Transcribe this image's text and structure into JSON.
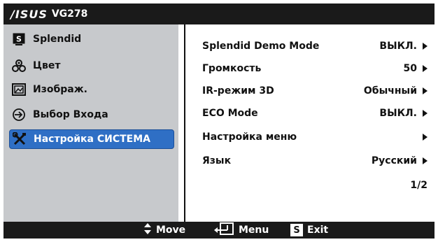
{
  "header": {
    "brand_logo": "/ISUS",
    "model": "VG278"
  },
  "sidebar": {
    "items": [
      {
        "label": "Splendid",
        "icon": "splendid-s-icon"
      },
      {
        "label": "Цвет",
        "icon": "color-drops-icon"
      },
      {
        "label": "Изображ.",
        "icon": "image-frame-icon"
      },
      {
        "label": "Выбор Входа",
        "icon": "input-arrow-icon"
      },
      {
        "label": "Настройка СИСТЕМА",
        "icon": "wrench-screwdriver-icon",
        "active": true
      }
    ],
    "active_bg": "#2f6fc5"
  },
  "settings": {
    "rows": [
      {
        "label": "Splendid Demo Mode",
        "value": "ВЫКЛ."
      },
      {
        "label": "Громкость",
        "value": "50"
      },
      {
        "label": "IR-режим 3D",
        "value": "Обычный"
      },
      {
        "label": "ECO Mode",
        "value": "ВЫКЛ."
      },
      {
        "label": "Настройка меню",
        "value": ""
      },
      {
        "label": "Язык",
        "value": "Русский"
      }
    ],
    "page_indicator": "1/2"
  },
  "footer": {
    "move_label": "Move",
    "menu_label": "Menu",
    "exit_label": "Exit",
    "exit_key": "S"
  },
  "colors": {
    "bar": "#1a1a1a",
    "sidebar_bg": "#c7c9cc",
    "accent": "#2f6fc5"
  }
}
